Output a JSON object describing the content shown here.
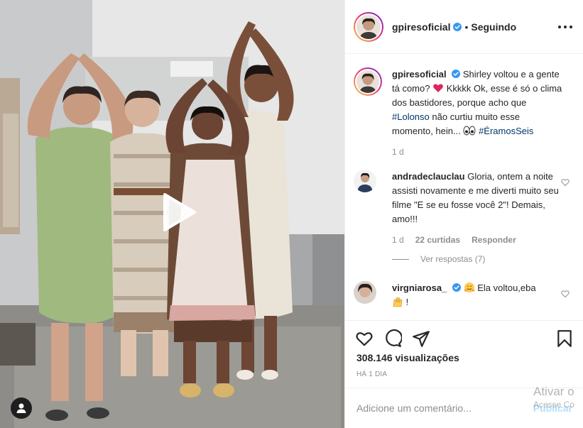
{
  "post": {
    "username": "gpiresoficial",
    "following_label": "Seguindo",
    "separator": "•"
  },
  "caption": {
    "username": "gpiresoficial",
    "text_part1": "Shirley voltou e a gente tá como?",
    "text_part2": "Kkkkk Ok, esse é só o clima dos bastidores, porque acho que",
    "hashtag1": "#Lolonso",
    "text_part3": "não curtiu muito esse momento, hein...",
    "hashtag2": "#ÉramosSeis",
    "time": "1 d",
    "emojis": [
      "red-heart",
      "eyes"
    ]
  },
  "comments": [
    {
      "username": "andradeclauclau",
      "text": "Gloria, ontem a noite assisti novamente e me diverti muito seu filme \"E se eu fosse você 2\"! Demais, amo!!!",
      "time": "1 d",
      "likes": "22 curtidas",
      "reply_label": "Responder",
      "view_replies": "Ver respostas (7)"
    },
    {
      "username": "virgniarosa_",
      "text": "Ela voltou,eba",
      "trailing": "!",
      "emojis": [
        "hugging-face",
        "raising-hands"
      ]
    }
  ],
  "views": "308.146 visualizações",
  "posted_ago": "HÁ 1 DIA",
  "add_comment": {
    "placeholder": "Adicione um comentário...",
    "publish_label": "Publicar"
  },
  "watermark": {
    "line1": "Ativar o",
    "line2": "Acesse Co"
  },
  "icons": [
    "verified-badge",
    "more-options-icon",
    "heart-icon",
    "comment-icon",
    "share-icon",
    "bookmark-icon",
    "play-icon",
    "user-tag-icon"
  ],
  "colors": {
    "link_blue": "#00376b",
    "verified_blue": "#3897f0",
    "publish_disabled": "#b2dffc",
    "secondary_text": "#8e8e8e"
  }
}
